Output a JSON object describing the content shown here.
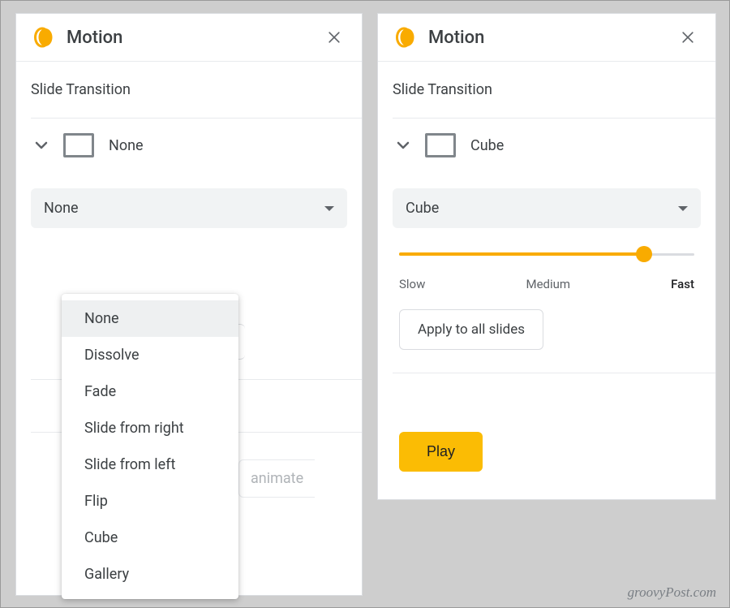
{
  "colors": {
    "accent": "#f9ab00",
    "play": "#fbbc04"
  },
  "watermark": "groovyPost.com",
  "left": {
    "title": "Motion",
    "section": "Slide Transition",
    "current_transition": "None",
    "dropdown_value": "None",
    "options": [
      "None",
      "Dissolve",
      "Fade",
      "Slide from right",
      "Slide from left",
      "Flip",
      "Cube",
      "Gallery"
    ],
    "selected_option_index": 0,
    "peek_text": "animate"
  },
  "right": {
    "title": "Motion",
    "section": "Slide Transition",
    "current_transition": "Cube",
    "dropdown_value": "Cube",
    "speed_labels": {
      "slow": "Slow",
      "medium": "Medium",
      "fast": "Fast"
    },
    "speed_value_percent": 83,
    "apply_label": "Apply to all slides",
    "play_label": "Play"
  }
}
